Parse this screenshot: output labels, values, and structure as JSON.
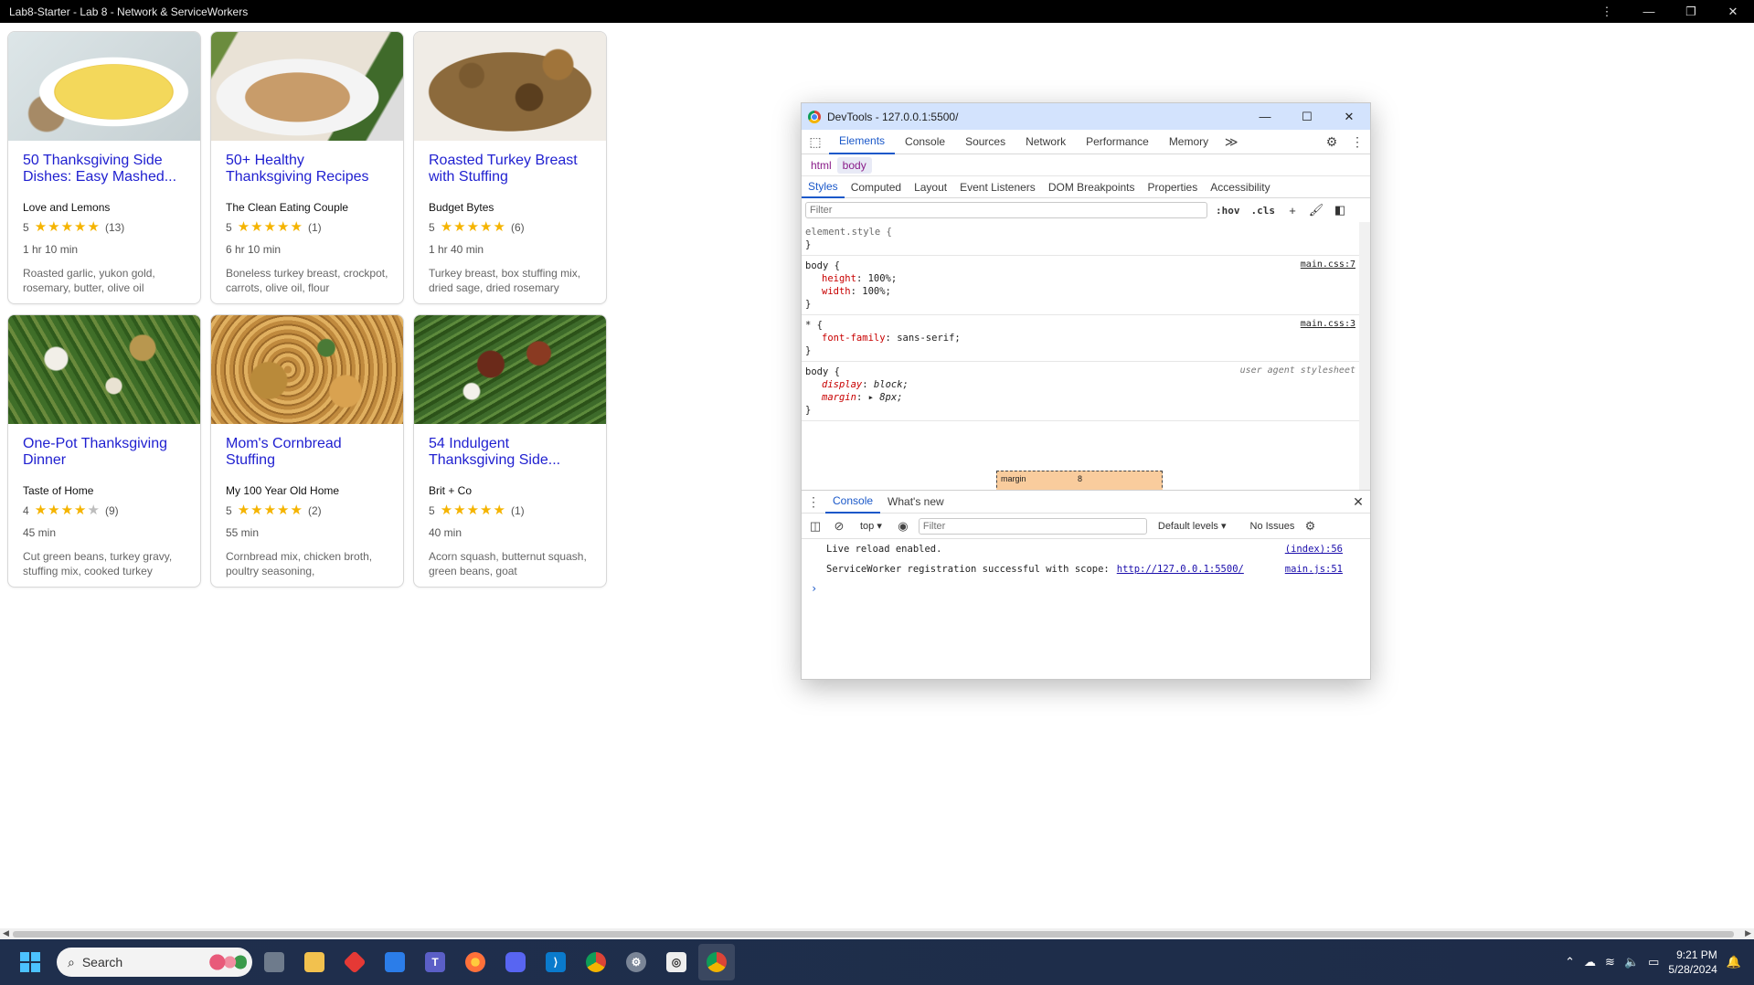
{
  "window": {
    "title": "Lab8-Starter - Lab 8 - Network & ServiceWorkers",
    "controls": {
      "menu": "⋮",
      "minimize": "—",
      "restore": "❐",
      "close": "✕"
    }
  },
  "recipes": [
    {
      "title": "50 Thanksgiving Side Dishes: Easy Mashed...",
      "org": "Love and Lemons",
      "rating": "5",
      "stars": 5,
      "reviews": "(13)",
      "time": "1 hr 10 min",
      "ingredients": "Roasted garlic, yukon gold, rosemary, butter, olive oil",
      "image": "mashed-potatoes"
    },
    {
      "title": "50+ Healthy Thanksgiving Recipes",
      "org": "The Clean Eating Couple",
      "rating": "5",
      "stars": 5,
      "reviews": "(1)",
      "time": "6 hr 10 min",
      "ingredients": "Boneless turkey breast, crockpot, carrots, olive oil, flour",
      "image": "turkey-plate"
    },
    {
      "title": "Roasted Turkey Breast with Stuffing",
      "org": "Budget Bytes",
      "rating": "5",
      "stars": 5,
      "reviews": "(6)",
      "time": "1 hr 40 min",
      "ingredients": "Turkey breast, box stuffing mix, dried sage, dried rosemary",
      "image": "turkey-stuffing"
    },
    {
      "title": "One-Pot Thanksgiving Dinner",
      "org": "Taste of Home",
      "rating": "4",
      "stars": 4,
      "reviews": "(9)",
      "time": "45 min",
      "ingredients": "Cut green beans, turkey gravy, stuffing mix, cooked turkey",
      "image": "one-pot-dinner"
    },
    {
      "title": "Mom's Cornbread Stuffing",
      "org": "My 100 Year Old Home",
      "rating": "5",
      "stars": 5,
      "reviews": "(2)",
      "time": "55 min",
      "ingredients": "Cornbread mix, chicken broth, poultry seasoning,",
      "image": "cornbread-stuffing"
    },
    {
      "title": "54 Indulgent Thanksgiving Side...",
      "org": "Brit + Co",
      "rating": "5",
      "stars": 5,
      "reviews": "(1)",
      "time": "40 min",
      "ingredients": "Acorn squash, butternut squash, green beans, goat",
      "image": "green-beans"
    }
  ],
  "devtools": {
    "title": "DevTools - 127.0.0.1:5500/",
    "tabs": [
      "Elements",
      "Console",
      "Sources",
      "Network",
      "Performance",
      "Memory"
    ],
    "more_tabs": "≫",
    "breadcrumbs": [
      "html",
      "body"
    ],
    "style_tabs": [
      "Styles",
      "Computed",
      "Layout",
      "Event Listeners",
      "DOM Breakpoints",
      "Properties",
      "Accessibility"
    ],
    "filter_placeholder": "Filter",
    "hov": ":hov",
    "cls": ".cls",
    "rules": {
      "element_style": "element.style {",
      "close": "}",
      "body1_selector": "body {",
      "body1_source": "main.css:7",
      "body1_decls": [
        {
          "prop": "height",
          "val": "100%;"
        },
        {
          "prop": "width",
          "val": "100%;"
        }
      ],
      "star_selector": "* {",
      "star_source": "main.css:3",
      "star_decls": [
        {
          "prop": "font-family",
          "val": "sans-serif;"
        }
      ],
      "ua_selector": "body {",
      "ua_source": "user agent stylesheet",
      "ua_decls": [
        {
          "prop": "display",
          "val": "block;"
        },
        {
          "prop": "margin",
          "val": "▸ 8px;"
        }
      ]
    },
    "box_model": {
      "label": "margin",
      "value": "8"
    },
    "drawer_tabs": [
      "Console",
      "What's new"
    ],
    "console": {
      "context": "top ▾",
      "filter_placeholder": "Filter",
      "levels": "Default levels ▾",
      "issues": "No Issues",
      "messages": [
        {
          "text": "Live reload enabled.",
          "link": "",
          "source": "(index):56"
        },
        {
          "text": "ServiceWorker registration successful with scope:",
          "link": "http://127.0.0.1:5500/",
          "source": "main.js:51"
        }
      ],
      "prompt": "›"
    }
  },
  "taskbar": {
    "search_placeholder": "Search",
    "apps": [
      "task-view",
      "file-explorer",
      "git",
      "store",
      "teams",
      "firefox",
      "discord",
      "vscode",
      "chrome",
      "settings",
      "github-desktop",
      "chrome-active"
    ],
    "clock_time": "9:21 PM",
    "clock_date": "5/28/2024"
  },
  "colors": {
    "link_title": "#1f1fd0",
    "star": "#f5b400",
    "devtools_accent": "#1a58c9",
    "taskbar": "#1f2f4d"
  }
}
